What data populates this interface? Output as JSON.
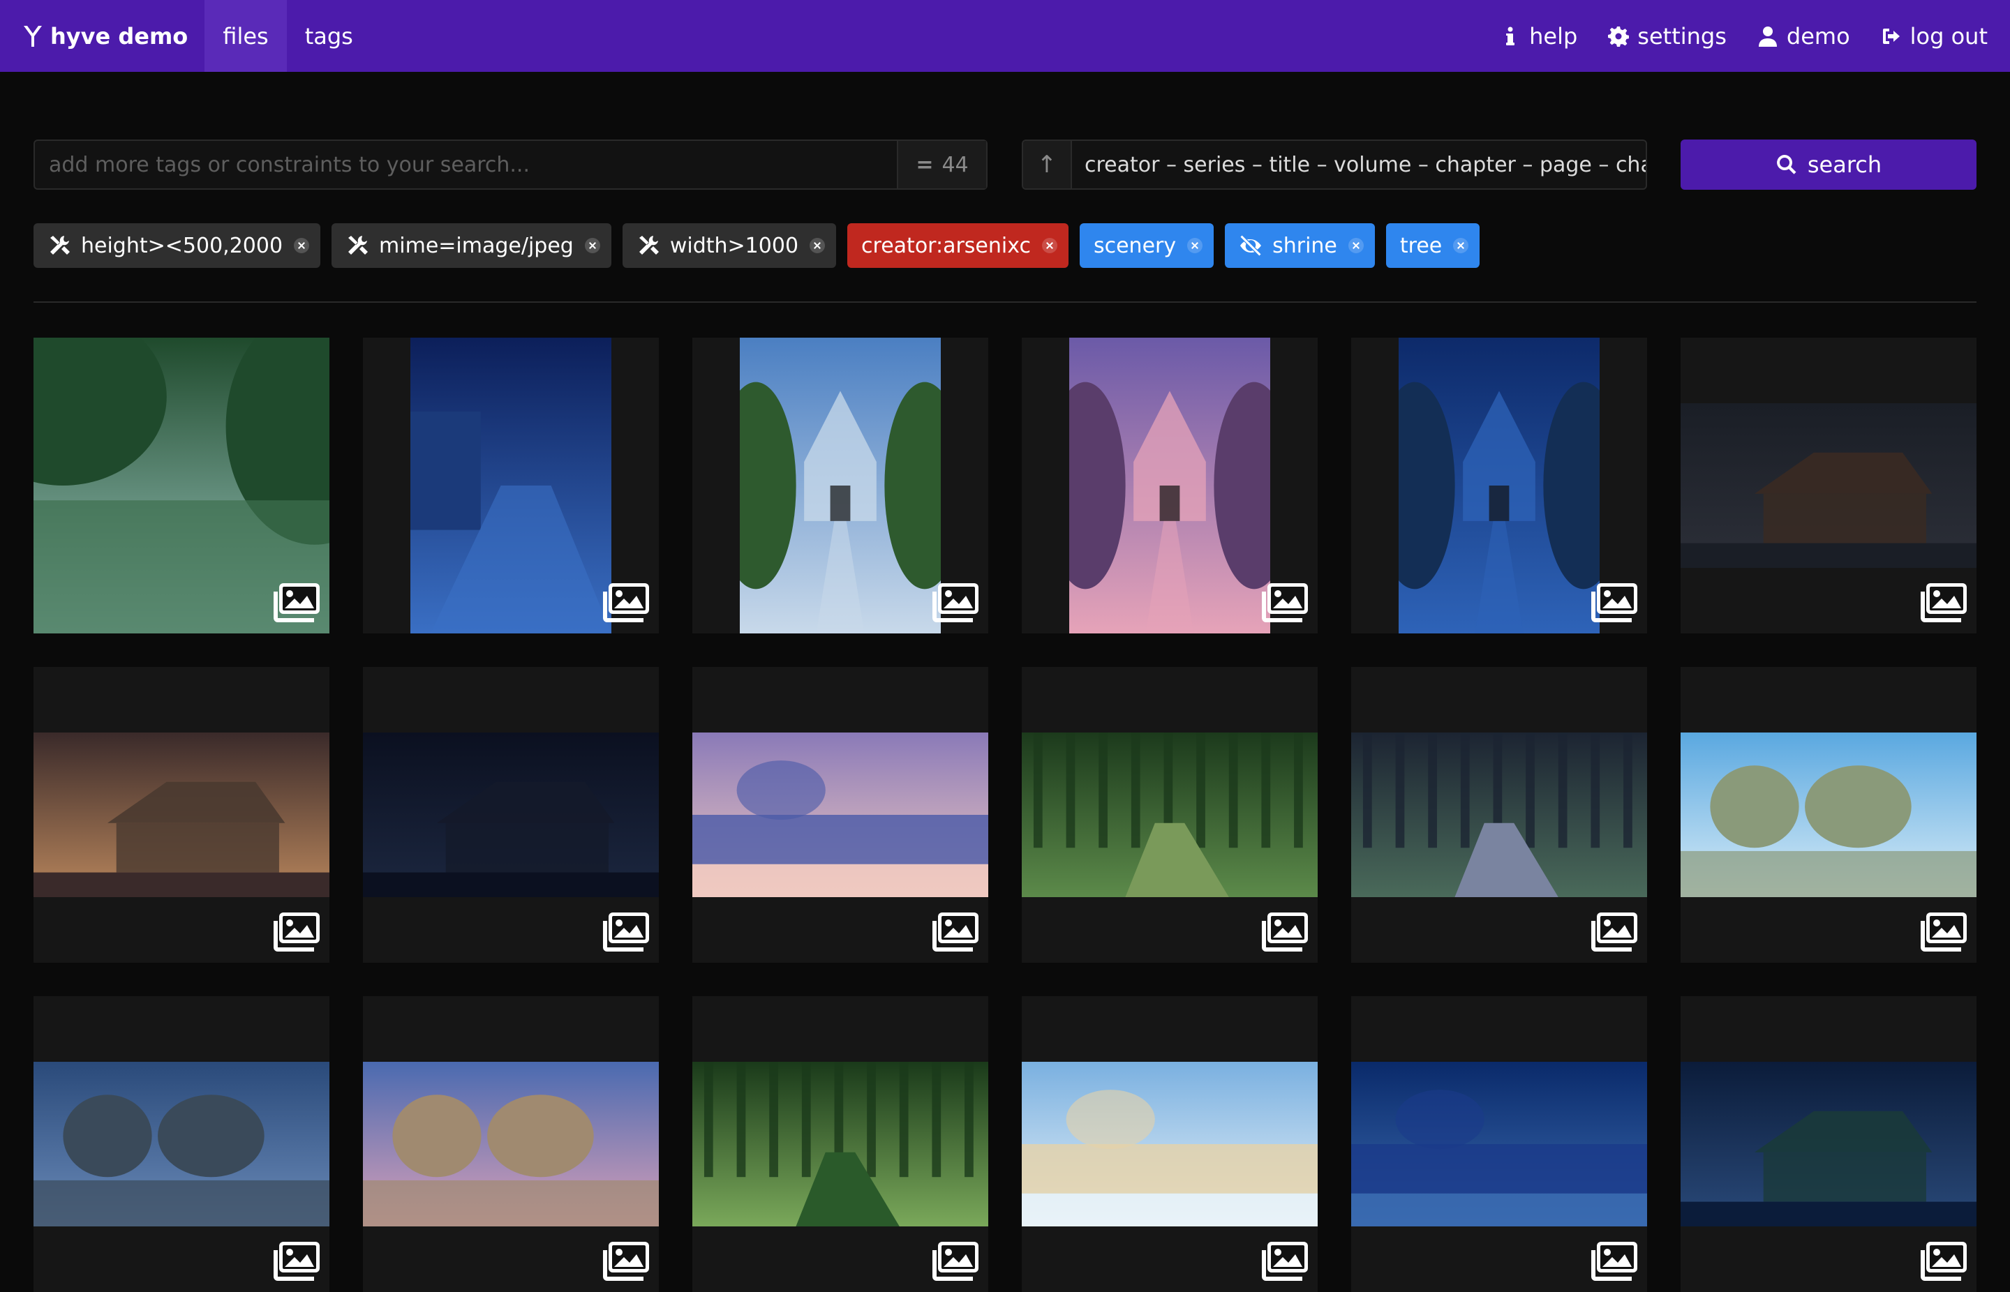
{
  "nav": {
    "brand": "hyve demo",
    "links": [
      {
        "label": "files",
        "active": true
      },
      {
        "label": "tags",
        "active": false
      }
    ],
    "right": [
      {
        "label": "help",
        "icon": "info-icon"
      },
      {
        "label": "settings",
        "icon": "gear-icon"
      },
      {
        "label": "demo",
        "icon": "user-icon"
      },
      {
        "label": "log out",
        "icon": "logout-icon"
      }
    ]
  },
  "search": {
    "placeholder": "add more tags or constraints to your search...",
    "value": "",
    "count": "44",
    "sort_direction": "↑",
    "sort_value": "creator – series – title – volume – chapter – page – charact",
    "button_label": "search"
  },
  "active_tags": [
    {
      "label": "height><500,2000",
      "kind": "constraint",
      "icon": "tools-icon"
    },
    {
      "label": "mime=image/jpeg",
      "kind": "constraint",
      "icon": "tools-icon"
    },
    {
      "label": "width>1000",
      "kind": "constraint",
      "icon": "tools-icon"
    },
    {
      "label": "creator:arsenixc",
      "kind": "creator",
      "icon": ""
    },
    {
      "label": "scenery",
      "kind": "general",
      "icon": ""
    },
    {
      "label": "shrine",
      "kind": "general",
      "icon": "eye-slash-icon"
    },
    {
      "label": "tree",
      "kind": "general",
      "icon": ""
    }
  ],
  "colors": {
    "nav_bg": "#4c1bab",
    "creator_tag": "#c0281f",
    "general_tag": "#2f86ee",
    "constraint_tag": "#2f2f2f"
  },
  "thumbnails": [
    {
      "shape": "full",
      "scene": "lake-forest"
    },
    {
      "shape": "portrait",
      "scene": "night-path-fence"
    },
    {
      "shape": "portrait",
      "scene": "church-day"
    },
    {
      "shape": "portrait",
      "scene": "church-sunset"
    },
    {
      "shape": "portrait",
      "scene": "church-night"
    },
    {
      "shape": "landscape",
      "scene": "dark-wooden-house"
    },
    {
      "shape": "landscape",
      "scene": "camp-sunset"
    },
    {
      "shape": "landscape",
      "scene": "cabin-night"
    },
    {
      "shape": "landscape",
      "scene": "beach-sunset"
    },
    {
      "shape": "landscape",
      "scene": "forest-path-day"
    },
    {
      "shape": "landscape",
      "scene": "forest-path-dusk"
    },
    {
      "shape": "landscape",
      "scene": "camp-day"
    },
    {
      "shape": "landscape",
      "scene": "camp-evening-blue"
    },
    {
      "shape": "landscape",
      "scene": "camp-evening-pink"
    },
    {
      "shape": "landscape",
      "scene": "green-forest"
    },
    {
      "shape": "landscape",
      "scene": "beach-day"
    },
    {
      "shape": "landscape",
      "scene": "beach-night"
    },
    {
      "shape": "landscape",
      "scene": "house-night-blue"
    }
  ]
}
